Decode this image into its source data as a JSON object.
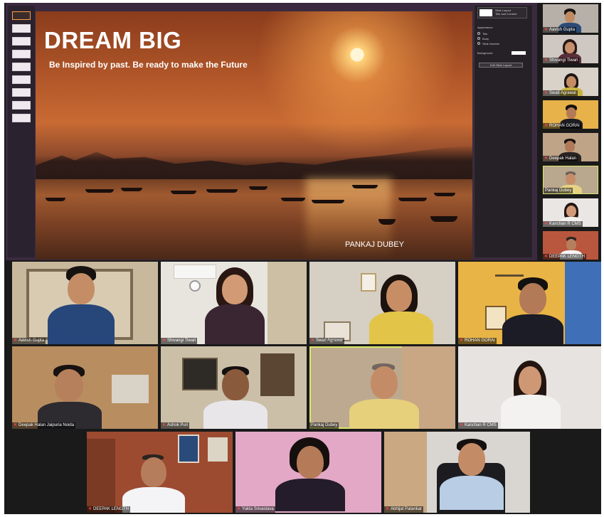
{
  "slide": {
    "title": "DREAM BIG",
    "subtitle": "Be Inspired by past. Be ready to make the Future",
    "credit": "PANKAJ DUBEY"
  },
  "design_panel": {
    "header": "Slide Layout",
    "layout_name": "Title and Content",
    "section": "Appearance",
    "options": [
      "Title",
      "Body",
      "Slide Number"
    ],
    "background_label": "Background",
    "edit_button": "Edit Slide Layout"
  },
  "participants_strip": [
    {
      "name": "Aavish Gupta"
    },
    {
      "name": "Shivangi Tiwari"
    },
    {
      "name": "Swati Agrawal"
    },
    {
      "name": "ROHAN GORAI"
    },
    {
      "name": "Deepak Halan"
    },
    {
      "name": "Pankaj Dubey"
    },
    {
      "name": "Kanchan R CMS"
    },
    {
      "name": "DEEPAK LENGTH"
    }
  ],
  "grid": [
    {
      "name": "Aavish Gupta"
    },
    {
      "name": "Shivangi Tiwari"
    },
    {
      "name": "Swati Agrawal"
    },
    {
      "name": "ROHAN GORAI"
    },
    {
      "name": "Deepak Halan Jaipuria Noida"
    },
    {
      "name": "Ashok Puri"
    },
    {
      "name": "Pankaj Dubey"
    },
    {
      "name": "Kanchan R CMS"
    },
    {
      "name": "DEEPAK LENGTH"
    },
    {
      "name": "Yukta Srivastava"
    },
    {
      "name": "Abhijat Patankar"
    }
  ],
  "colors": {
    "active_speaker": "#d9e86b",
    "mic_muted": "#ff4a4a"
  }
}
